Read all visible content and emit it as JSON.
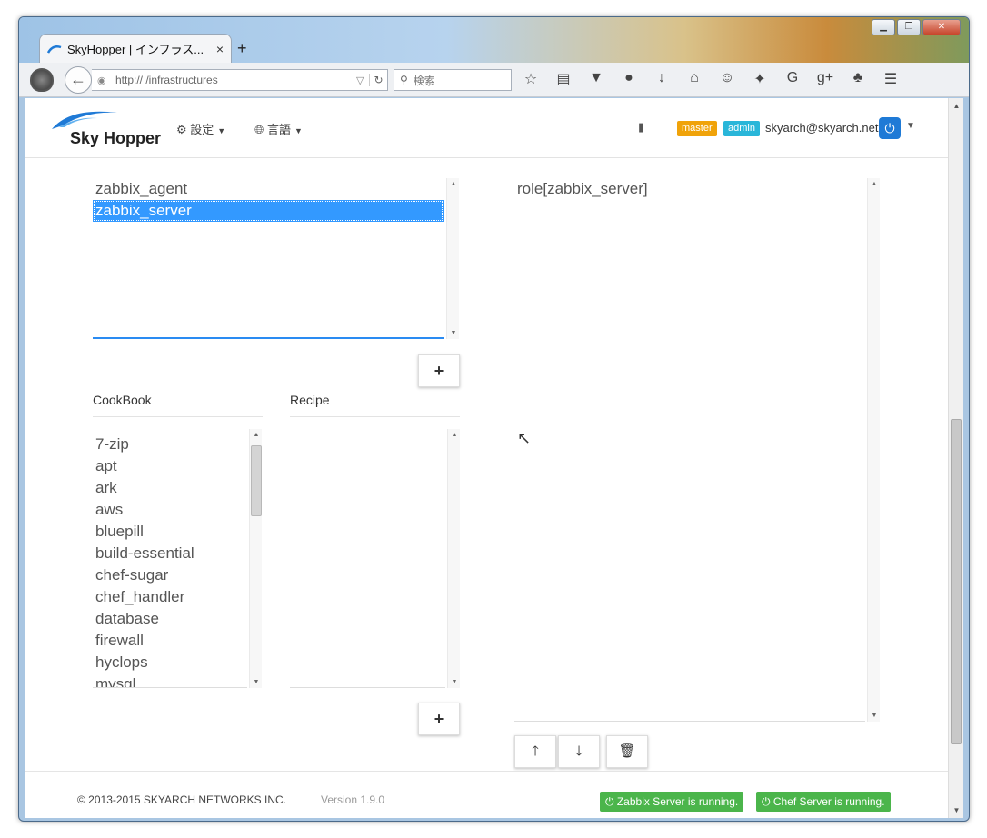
{
  "browser": {
    "tab_title": "SkyHopper | インフラス...",
    "tab_close": "×",
    "new_tab": "+",
    "url": "http://                  /infrastructures",
    "search_placeholder": "検索",
    "window_controls": {
      "minimize": "▁",
      "maximize": "❐",
      "close": "✕"
    }
  },
  "header": {
    "logo_text": "Sky Hopper",
    "menu_settings": "設定",
    "menu_language": "言語",
    "badge_master": "master",
    "badge_admin": "admin",
    "user_email": "skyarch@skyarch.net"
  },
  "roles": {
    "items": [
      "zabbix_agent",
      "zabbix_server"
    ],
    "selected": "zabbix_server",
    "add_label": "+"
  },
  "cookbook": {
    "heading": "CookBook",
    "items": [
      "7-zip",
      "apt",
      "ark",
      "aws",
      "bluepill",
      "build-essential",
      "chef-sugar",
      "chef_handler",
      "database",
      "firewall",
      "hyclops",
      "mysql"
    ]
  },
  "recipe": {
    "heading": "Recipe",
    "items": [],
    "add_label": "+"
  },
  "runlist": {
    "items": [
      "role[zabbix_server]"
    ],
    "move_up": "🡑",
    "move_down": "🡓",
    "delete": "🗑"
  },
  "footer": {
    "copyright": "© 2013-2015 SKYARCH NETWORKS INC.",
    "version": "Version 1.9.0",
    "status_zabbix": "Zabbix Server is running.",
    "status_chef": "Chef Server is running."
  },
  "colors": {
    "accent": "#3399ff",
    "status_green": "#4bb54b",
    "badge_master": "#f0a30a",
    "badge_admin": "#29b6d9",
    "power_button": "#1f7ad6"
  }
}
